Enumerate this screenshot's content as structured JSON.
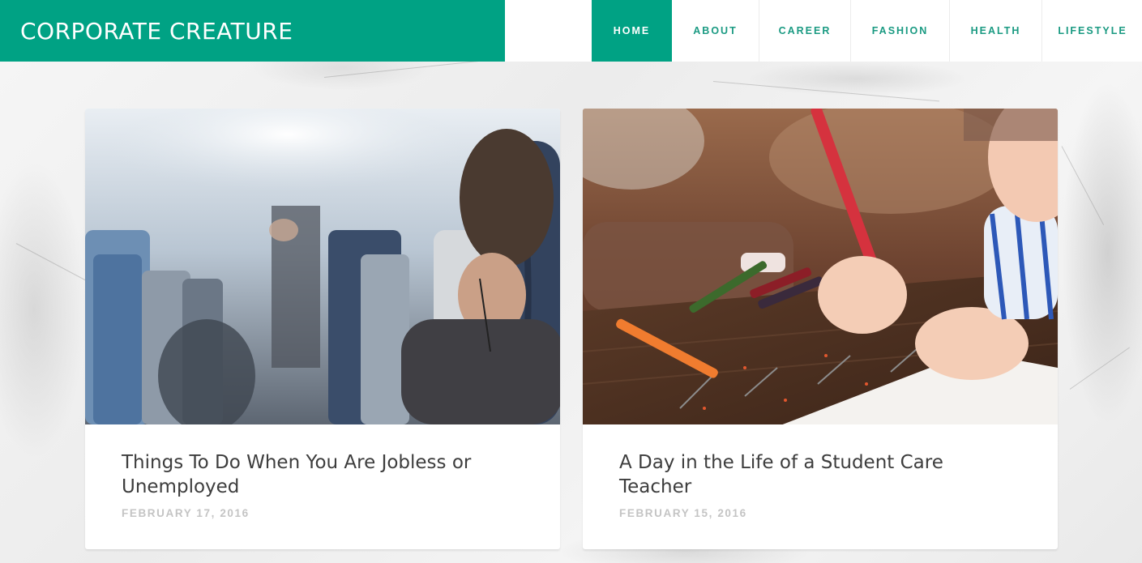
{
  "site": {
    "brand": "CORPORATE CREATURE",
    "accent": "#00a284"
  },
  "nav": {
    "items": [
      {
        "label": "HOME",
        "active": true
      },
      {
        "label": "ABOUT",
        "active": false
      },
      {
        "label": "CAREER",
        "active": false
      },
      {
        "label": "FASHION",
        "active": false
      },
      {
        "label": "HEALTH",
        "active": false
      },
      {
        "label": "LIFESTYLE",
        "active": false
      }
    ]
  },
  "posts": [
    {
      "title": "Things To Do When You Are Jobless or Unemployed",
      "date": "FEBRUARY 17, 2016",
      "image": "airplane-cabin-photo"
    },
    {
      "title": "A Day in the Life of a Student Care Teacher",
      "date": "FEBRUARY 15, 2016",
      "image": "child-drawing-with-pencils-photo"
    }
  ]
}
